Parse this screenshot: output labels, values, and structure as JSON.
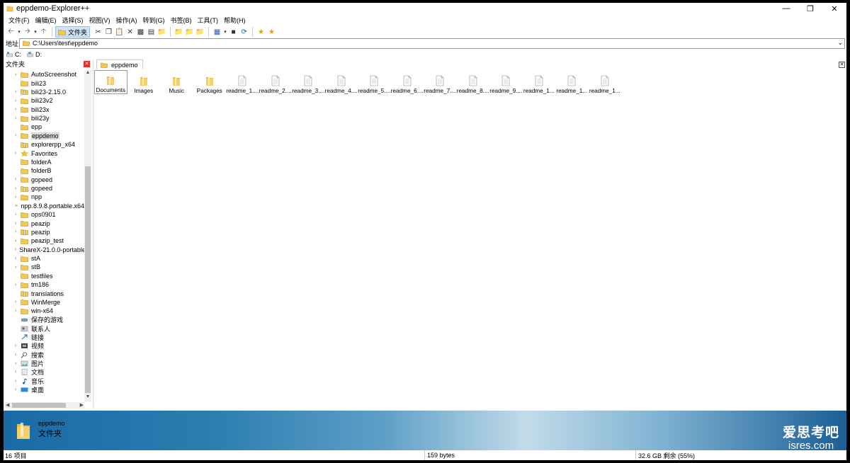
{
  "window": {
    "title": "eppdemo-Explorer++"
  },
  "menu": [
    "文件(F)",
    "编辑(E)",
    "选择(S)",
    "视图(V)",
    "操作(A)",
    "转到(G)",
    "书签(B)",
    "工具(T)",
    "帮助(H)"
  ],
  "toolbar": {
    "folders_label": "文件夹"
  },
  "address": {
    "label": "地址",
    "value": "C:\\Users\\test\\eppdemo"
  },
  "drives": [
    {
      "label": "C:"
    },
    {
      "label": "D:"
    }
  ],
  "tree": {
    "header": "文件夹",
    "items": [
      {
        "label": "AutoScreenshot",
        "icon": "folder",
        "expandable": true
      },
      {
        "label": "bili23",
        "icon": "folder",
        "expandable": false
      },
      {
        "label": "bili23-2.15.0",
        "icon": "zip-folder",
        "expandable": true
      },
      {
        "label": "bili23v2",
        "icon": "folder",
        "expandable": true
      },
      {
        "label": "bili23x",
        "icon": "folder",
        "expandable": true
      },
      {
        "label": "bili23y",
        "icon": "folder",
        "expandable": true
      },
      {
        "label": "epp",
        "icon": "folder",
        "expandable": false
      },
      {
        "label": "eppdemo",
        "icon": "folder",
        "expandable": true,
        "selected": true
      },
      {
        "label": "explorerpp_x64",
        "icon": "zip-folder",
        "expandable": false
      },
      {
        "label": "Favorites",
        "icon": "star",
        "expandable": true
      },
      {
        "label": "folderA",
        "icon": "folder",
        "expandable": false
      },
      {
        "label": "folderB",
        "icon": "folder",
        "expandable": false
      },
      {
        "label": "gopeed",
        "icon": "folder",
        "expandable": true
      },
      {
        "label": "gopeed",
        "icon": "zip-folder",
        "expandable": true
      },
      {
        "label": "npp",
        "icon": "folder",
        "expandable": true
      },
      {
        "label": "npp.8.9.8.portable.x64",
        "icon": "zip-folder",
        "expandable": true
      },
      {
        "label": "ops0901",
        "icon": "folder",
        "expandable": true
      },
      {
        "label": "peazip",
        "icon": "folder",
        "expandable": true
      },
      {
        "label": "peazip",
        "icon": "zip-folder",
        "expandable": true
      },
      {
        "label": "peazip_test",
        "icon": "folder",
        "expandable": true
      },
      {
        "label": "ShareX-21.0.0-portable",
        "icon": "zip-folder",
        "expandable": true
      },
      {
        "label": "stA",
        "icon": "folder",
        "expandable": true
      },
      {
        "label": "stB",
        "icon": "folder",
        "expandable": true
      },
      {
        "label": "testfiles",
        "icon": "folder",
        "expandable": false
      },
      {
        "label": "tm186",
        "icon": "folder",
        "expandable": true
      },
      {
        "label": "translations",
        "icon": "zip-folder",
        "expandable": false
      },
      {
        "label": "WinMerge",
        "icon": "folder",
        "expandable": true
      },
      {
        "label": "win-x64",
        "icon": "folder",
        "expandable": true
      },
      {
        "label": "保存的游戏",
        "icon": "games",
        "expandable": false
      },
      {
        "label": "联系人",
        "icon": "contacts",
        "expandable": false
      },
      {
        "label": "链接",
        "icon": "links",
        "expandable": false
      },
      {
        "label": "视频",
        "icon": "video",
        "expandable": true
      },
      {
        "label": "搜索",
        "icon": "search",
        "expandable": true
      },
      {
        "label": "图片",
        "icon": "pictures",
        "expandable": true
      },
      {
        "label": "文档",
        "icon": "documents",
        "expandable": true
      },
      {
        "label": "音乐",
        "icon": "music",
        "expandable": true
      },
      {
        "label": "桌面",
        "icon": "desktop",
        "expandable": true
      }
    ]
  },
  "tab": {
    "label": "eppdemo"
  },
  "files": [
    {
      "name": "Documents",
      "type": "folder",
      "selected": true
    },
    {
      "name": "Images",
      "type": "folder"
    },
    {
      "name": "Music",
      "type": "folder"
    },
    {
      "name": "Packages",
      "type": "folder"
    },
    {
      "name": "readme_1....",
      "type": "file"
    },
    {
      "name": "readme_2....",
      "type": "file"
    },
    {
      "name": "readme_3....",
      "type": "file"
    },
    {
      "name": "readme_4....",
      "type": "file"
    },
    {
      "name": "readme_5....",
      "type": "file"
    },
    {
      "name": "readme_6....",
      "type": "file"
    },
    {
      "name": "readme_7....",
      "type": "file"
    },
    {
      "name": "readme_8....",
      "type": "file"
    },
    {
      "name": "readme_9....",
      "type": "file"
    },
    {
      "name": "readme_1...",
      "type": "file"
    },
    {
      "name": "readme_1...",
      "type": "file"
    },
    {
      "name": "readme_1...",
      "type": "file"
    }
  ],
  "info": {
    "name": "eppdemo",
    "type": "文件夹"
  },
  "watermark": {
    "cn": "爱思考吧",
    "en": "isres.com"
  },
  "status": {
    "items": "16 项目",
    "size": "159 bytes",
    "free": "32.6 GB 剩余 (55%)"
  },
  "colors": {
    "folder": "#f5c84c",
    "selection": "#cde3f7",
    "info_gradient_start": "#1a6aa5",
    "info_gradient_end": "#1b5f96"
  }
}
